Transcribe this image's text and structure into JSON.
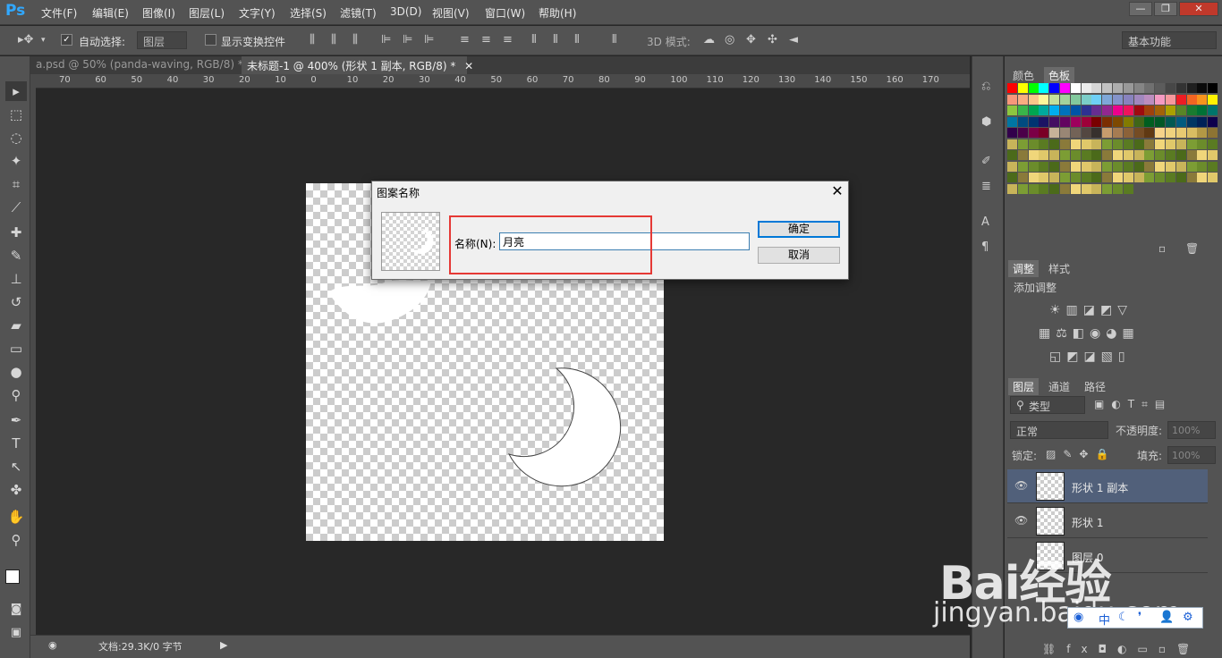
{
  "app": {
    "logo": "Ps"
  },
  "menu": [
    "文件(F)",
    "编辑(E)",
    "图像(I)",
    "图层(L)",
    "文字(Y)",
    "选择(S)",
    "滤镜(T)",
    "3D(D)",
    "视图(V)",
    "窗口(W)",
    "帮助(H)"
  ],
  "window_controls": {
    "minimize": "—",
    "restore": "❐",
    "close": "✕"
  },
  "options": {
    "auto_select_label": "自动选择:",
    "auto_select_value": "图层",
    "show_transform_label": "显示变换控件",
    "mode_3d_label": "3D 模式:",
    "workspace": "基本功能"
  },
  "tabs": [
    {
      "label": "a.psd @ 50% (panda-waving, RGB/8) *",
      "active": false
    },
    {
      "label": "未标题-1 @ 400% (形状 1 副本, RGB/8) *",
      "active": true
    }
  ],
  "ruler_ticks": [
    "70",
    "60",
    "50",
    "40",
    "30",
    "20",
    "10",
    "0",
    "10",
    "20",
    "30",
    "40",
    "50",
    "60",
    "70",
    "80",
    "90",
    "100",
    "110",
    "120",
    "130",
    "140",
    "150",
    "160",
    "170"
  ],
  "status": {
    "doc_info": "文档:29.3K/0 字节"
  },
  "dialog": {
    "title": "图案名称",
    "name_label": "名称(N):",
    "name_value": "月亮",
    "ok_label": "确定",
    "cancel_label": "取消",
    "highlight_color": "#e53935"
  },
  "panels": {
    "color_tabs": [
      "颜色",
      "色板"
    ],
    "adjust_tabs": [
      "调整",
      "样式"
    ],
    "adjust_hint": "添加调整",
    "layer_tabs": [
      "图层",
      "通道",
      "路径"
    ],
    "filter_kind": "类型",
    "blend_mode": "正常",
    "opacity_label": "不透明度:",
    "opacity_value": "100%",
    "lock_label": "锁定:",
    "fill_label": "填充:",
    "fill_value": "100%"
  },
  "layers": [
    {
      "name": "形状 1 副本",
      "selected": true
    },
    {
      "name": "形状 1",
      "selected": false
    },
    {
      "name": "图层 0",
      "selected": false
    }
  ],
  "watermark": {
    "brand": "Bai经验",
    "url": "jingyan.baidu.com",
    "ime_lang": "中"
  },
  "colors": {
    "accent": "#31a8ff",
    "selection": "#51607a",
    "bg": "#282828"
  }
}
